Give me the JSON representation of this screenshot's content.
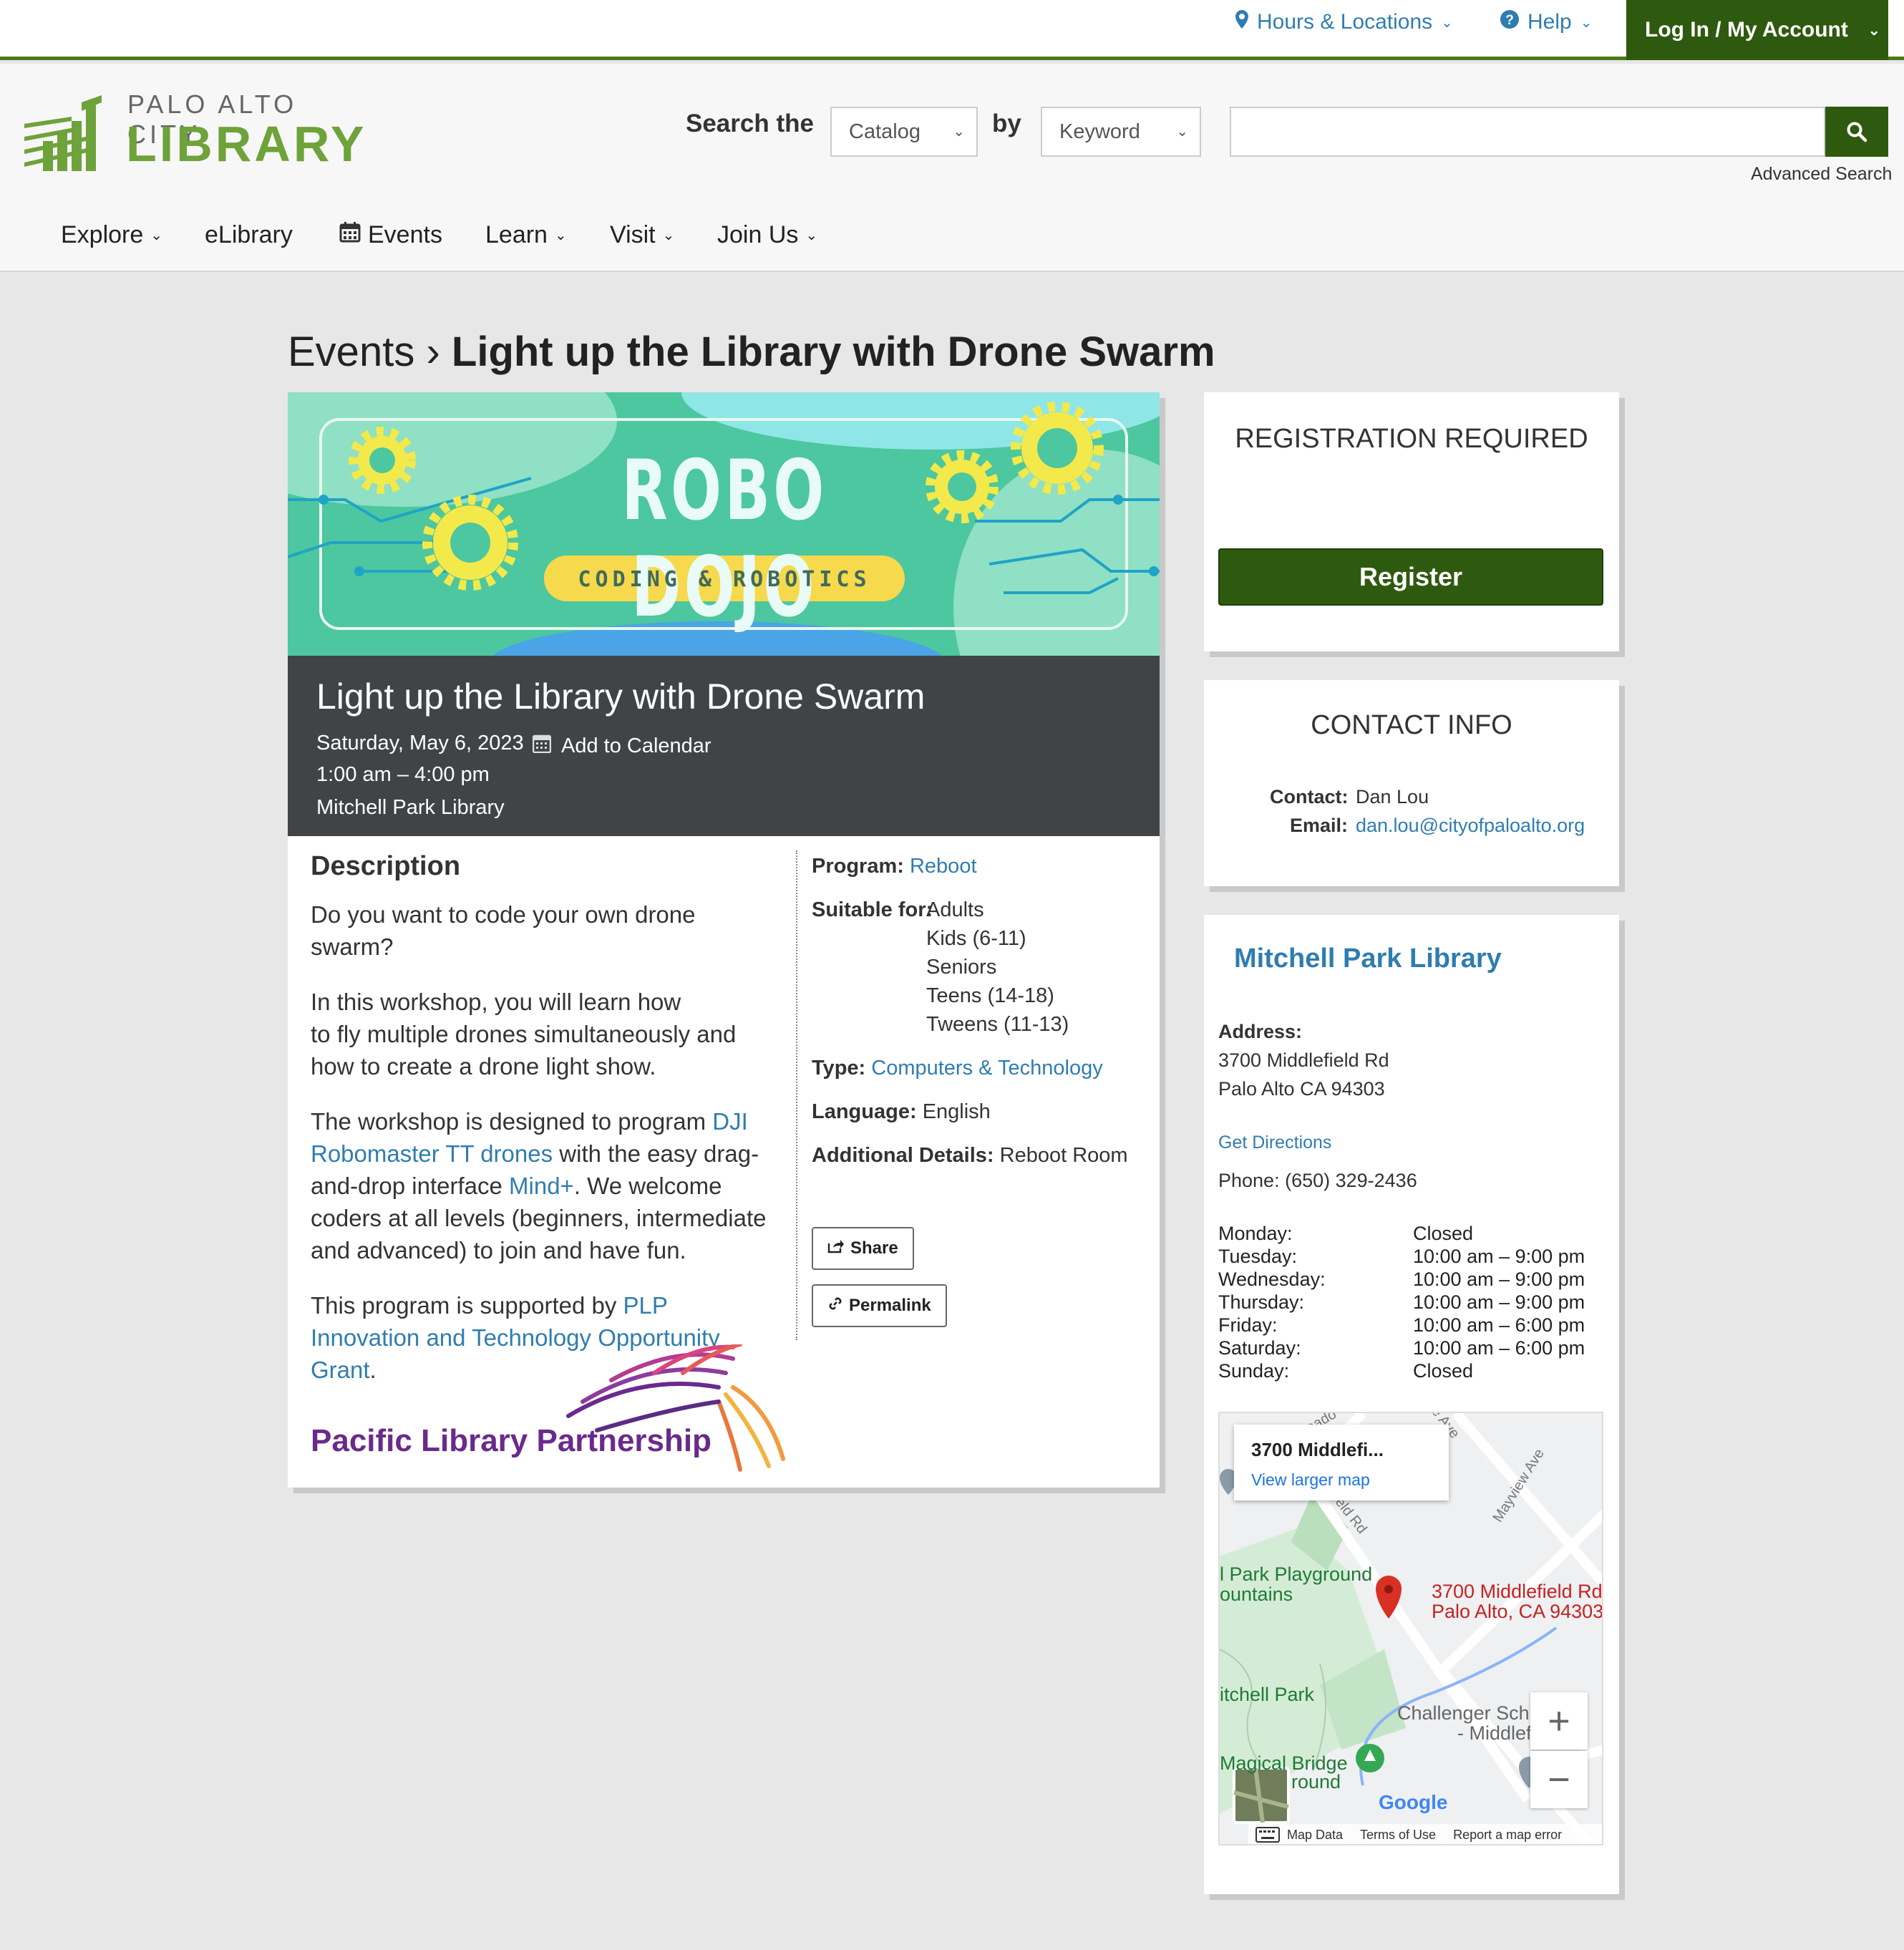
{
  "topbar": {
    "hours": "Hours & Locations",
    "help": "Help",
    "login": "Log In / My Account"
  },
  "logo": {
    "line1": "PALO ALTO CITY",
    "line2": "LIBRARY"
  },
  "search": {
    "label1": "Search the",
    "scope": "Catalog",
    "label2": "by",
    "by": "Keyword",
    "query": "",
    "advanced": "Advanced Search"
  },
  "nav": [
    "Explore",
    "eLibrary",
    "Events",
    "Learn",
    "Visit",
    "Join Us"
  ],
  "breadcrumb": {
    "parent": "Events",
    "separator": "›",
    "current": "Light up the Library with Drone Swarm"
  },
  "banner": {
    "title": "ROBO DOJO",
    "subtitle": "CODING & ROBOTICS"
  },
  "event": {
    "title": "Light up the Library with Drone Swarm",
    "date": "Saturday, May 6, 2023",
    "add_calendar": "Add to Calendar",
    "time": "1:00 am – 4:00 pm",
    "location": "Mitchell Park Library"
  },
  "description": {
    "heading": "Description",
    "p1": "Do you want to code your own drone swarm?",
    "p2a": "In this workshop, you will learn how",
    "p2b": "to fly multiple drones simultaneously and how to create a drone light show.",
    "p3_pre": "The workshop is designed to program ",
    "p3_link1": "DJI Robomaster TT drones",
    "p3_mid": " with the easy drag-and-drop interface ",
    "p3_link2": "Mind+",
    "p3_post": ". We welcome coders at all levels (beginners, intermediate and advanced) to join and have fun.",
    "p4_pre": "This program is supported by ",
    "p4_link": "PLP Innovation and Technology Opportunity Grant",
    "p4_post": ".",
    "partner": "Pacific Library Partnership"
  },
  "meta": {
    "program_label": "Program:",
    "program": "Reboot",
    "suitable_label": "Suitable for:",
    "suitable": [
      "Adults",
      "Kids (6-11)",
      "Seniors",
      "Teens (14-18)",
      "Tweens (11-13)"
    ],
    "type_label": "Type:",
    "type": "Computers & Technology",
    "language_label": "Language:",
    "language": "English",
    "details_label": "Additional Details:",
    "details": "Reboot Room",
    "share": "Share",
    "permalink": "Permalink"
  },
  "registration": {
    "heading": "REGISTRATION REQUIRED",
    "button": "Register"
  },
  "contact": {
    "heading": "CONTACT INFO",
    "contact_label": "Contact:",
    "contact": "Dan Lou",
    "email_label": "Email:",
    "email": "dan.lou@cityofpaloalto.org"
  },
  "branch": {
    "name": "Mitchell Park Library",
    "address_label": "Address:",
    "address1": "3700 Middlefield Rd",
    "address2": "Palo Alto CA 94303",
    "directions": "Get Directions",
    "phone": "Phone: (650) 329-2436",
    "hours": [
      {
        "day": "Monday:",
        "hours": "Closed"
      },
      {
        "day": "Tuesday:",
        "hours": "10:00 am – 9:00 pm"
      },
      {
        "day": "Wednesday:",
        "hours": "10:00 am – 9:00 pm"
      },
      {
        "day": "Thursday:",
        "hours": "10:00 am – 9:00 pm"
      },
      {
        "day": "Friday:",
        "hours": "10:00 am – 6:00 pm"
      },
      {
        "day": "Saturday:",
        "hours": "10:00 am – 6:00 pm"
      },
      {
        "day": "Sunday:",
        "hours": "Closed"
      }
    ]
  },
  "map": {
    "info_title": "3700 Middlefi...",
    "info_link": "View larger map",
    "pin_label1": "3700 Middlefield Rd",
    "pin_label2": "Palo Alto, CA 94303",
    "label_playground": "l Park Playground",
    "label_fountains": "ountains",
    "label_park": "itchell Park",
    "label_school1": "Challenger Sch",
    "label_school2": "- Middlefi",
    "label_bridge1": "Magical Bridge",
    "label_bridge2": "round",
    "street1": "Mayview Ave",
    "street2": "eld Rd",
    "street3": "eado",
    "street4": "e Ave",
    "google": "Google",
    "footer": [
      "Map Data",
      "Terms of Use",
      "Report a map error"
    ],
    "colors": {
      "park": "#c8e6c9",
      "pin": "#d93025",
      "road": "#ffffff"
    }
  },
  "colors": {
    "brand_green": "#2e5a0f",
    "logo_green": "#6ea23a",
    "link_blue": "#2f7db0",
    "event_header": "#404446"
  }
}
